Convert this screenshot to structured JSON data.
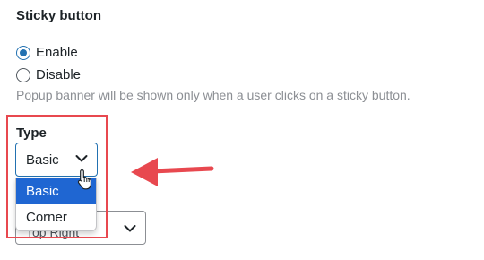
{
  "section": {
    "title": "Sticky button",
    "options": [
      {
        "label": "Enable",
        "checked": true
      },
      {
        "label": "Disable",
        "checked": false
      }
    ],
    "help_text": "Popup banner will be shown only when a user clicks on a sticky button."
  },
  "type_field": {
    "label": "Type",
    "selected": "Basic",
    "options": [
      "Basic",
      "Corner"
    ],
    "highlighted_option": "Basic"
  },
  "position_field": {
    "value": "Top Right"
  },
  "annotation": {
    "arrow_color": "#e8484f",
    "box_color": "#e8484f"
  },
  "colors": {
    "accent": "#2271b1",
    "highlight_bg": "#1f66d2"
  }
}
